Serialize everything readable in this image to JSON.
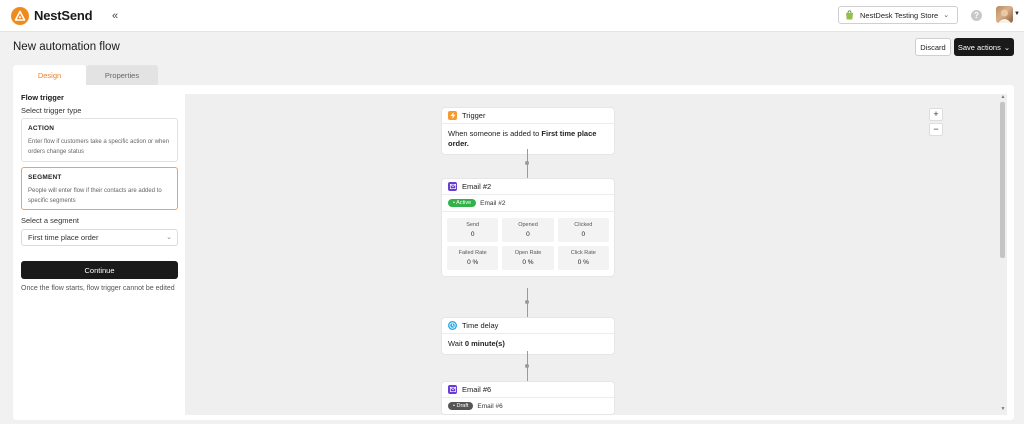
{
  "app": {
    "brand": "NestSend",
    "store_name": "NestDesk Testing Store"
  },
  "page": {
    "title": "New automation flow",
    "discard_label": "Discard",
    "save_label": "Save actions"
  },
  "tabs": [
    {
      "label": "Design",
      "active": true
    },
    {
      "label": "Properties",
      "active": false
    }
  ],
  "flow_trigger": {
    "title": "Flow trigger",
    "subtitle": "Select trigger type",
    "options": [
      {
        "title": "ACTION",
        "description": "Enter flow if customers take a specific action or when orders change status"
      },
      {
        "title": "SEGMENT",
        "description": "People will enter flow if their contacts are added to specific segments",
        "selected": true
      }
    ],
    "segment_label": "Select a segment",
    "segment_value": "First time place order",
    "continue_label": "Continue",
    "note": "Once the flow starts, flow trigger cannot be edited"
  },
  "canvas": {
    "zoom_in": "+",
    "zoom_out": "−",
    "nodes": {
      "trigger": {
        "title": "Trigger",
        "text_prefix": "When someone is added to ",
        "text_bold": "First time place order.",
        "icon": "lightning-icon",
        "color": "#f59a2e"
      },
      "email2": {
        "title": "Email #2",
        "status": "Active",
        "email_name": "Email #2",
        "icon": "envelope-icon",
        "color": "#6a3cd6",
        "stats": [
          {
            "label": "Send",
            "value": "0"
          },
          {
            "label": "Opened",
            "value": "0"
          },
          {
            "label": "Clicked",
            "value": "0"
          },
          {
            "label": "Failed Rate",
            "value": "0 %"
          },
          {
            "label": "Open Rate",
            "value": "0 %"
          },
          {
            "label": "Click Rate",
            "value": "0 %"
          }
        ]
      },
      "delay": {
        "title": "Time delay",
        "text_prefix": "Wait ",
        "text_bold": "0 minute(s)",
        "icon": "clock-icon",
        "color": "#2aa9e0"
      },
      "email6": {
        "title": "Email #6",
        "status": "Draft",
        "email_name": "Email #6",
        "icon": "envelope-icon",
        "color": "#6a3cd6"
      }
    }
  }
}
